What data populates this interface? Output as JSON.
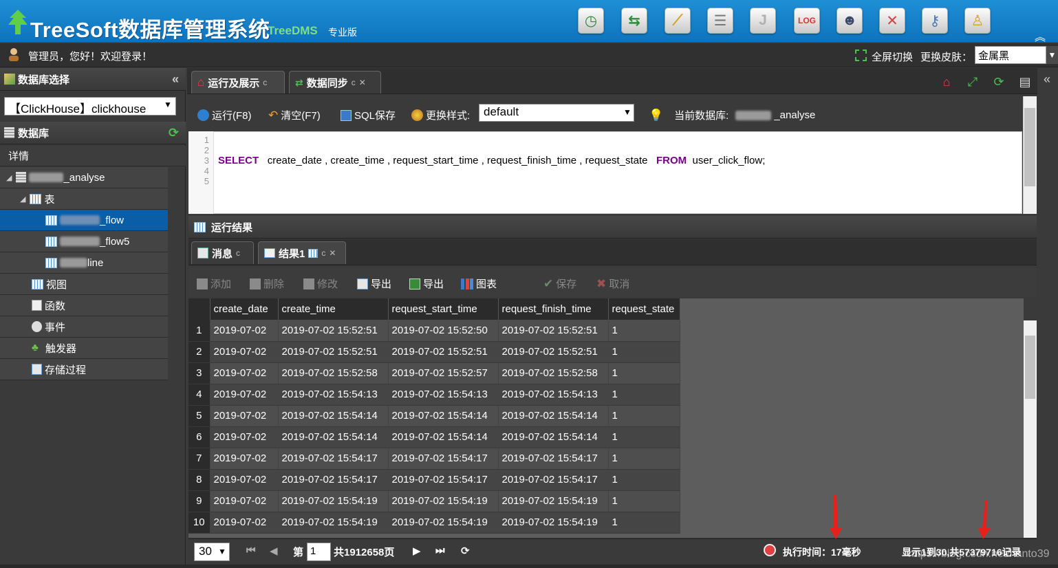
{
  "header": {
    "title": "TreeSoft数据库管理系统",
    "subtitle": "TreeDMS",
    "edition": "专业版",
    "toolbar_icons": [
      "clock-icon",
      "sync-arrows-icon",
      "chart-icon",
      "database-icon",
      "java-icon",
      "log-icon",
      "user-icon",
      "tools-icon",
      "key-icon",
      "person-icon"
    ]
  },
  "welcome": {
    "text": "管理员，您好！欢迎登录！",
    "fullscreen": "全屏切换",
    "skin_label": "更换皮肤：",
    "skin_value": "金属黑"
  },
  "sidebar": {
    "db_select_title": "数据库选择",
    "db_select_value": "【ClickHouse】clickhouse",
    "db_panel_title": "数据库",
    "details": "详情",
    "tree": {
      "db_name": "_analyse",
      "tables_label": "表",
      "tables": [
        "_flow",
        "_flow5",
        "line"
      ],
      "views": "视图",
      "functions": "函数",
      "events": "事件",
      "triggers": "触发器",
      "procedures": "存储过程"
    }
  },
  "tabs": [
    {
      "label": "运行及展示"
    },
    {
      "label": "数据同步"
    }
  ],
  "sql_toolbar": {
    "run": "运行(F8)",
    "clear": "清空(F7)",
    "save": "SQL保存",
    "style_label": "更换样式:",
    "style_value": "default",
    "current_db_label": "当前数据库:",
    "current_db_value": "_analyse"
  },
  "editor": {
    "line_numbers": [
      "1",
      "2",
      "3",
      "4",
      "5"
    ],
    "select_kw": "SELECT",
    "columns": "create_date , create_time , request_start_time , request_finish_time , request_state",
    "from_kw": "FROM",
    "table": "user_click_flow;"
  },
  "results": {
    "title": "运行结果",
    "tabs": [
      {
        "label": "消息"
      },
      {
        "label": "结果1"
      }
    ],
    "toolbar": {
      "add": "添加",
      "delete": "删除",
      "edit": "修改",
      "export1": "导出",
      "export2": "导出",
      "chart": "图表",
      "save": "保存",
      "cancel": "取消"
    },
    "columns": [
      "create_date",
      "create_time",
      "request_start_time",
      "request_finish_time",
      "request_state"
    ],
    "rows": [
      [
        "1",
        "2019-07-02",
        "2019-07-02 15:52:51",
        "2019-07-02 15:52:50",
        "2019-07-02 15:52:51",
        "1"
      ],
      [
        "2",
        "2019-07-02",
        "2019-07-02 15:52:51",
        "2019-07-02 15:52:51",
        "2019-07-02 15:52:51",
        "1"
      ],
      [
        "3",
        "2019-07-02",
        "2019-07-02 15:52:58",
        "2019-07-02 15:52:57",
        "2019-07-02 15:52:58",
        "1"
      ],
      [
        "4",
        "2019-07-02",
        "2019-07-02 15:54:13",
        "2019-07-02 15:54:13",
        "2019-07-02 15:54:13",
        "1"
      ],
      [
        "5",
        "2019-07-02",
        "2019-07-02 15:54:14",
        "2019-07-02 15:54:14",
        "2019-07-02 15:54:14",
        "1"
      ],
      [
        "6",
        "2019-07-02",
        "2019-07-02 15:54:14",
        "2019-07-02 15:54:14",
        "2019-07-02 15:54:14",
        "1"
      ],
      [
        "7",
        "2019-07-02",
        "2019-07-02 15:54:17",
        "2019-07-02 15:54:17",
        "2019-07-02 15:54:17",
        "1"
      ],
      [
        "8",
        "2019-07-02",
        "2019-07-02 15:54:17",
        "2019-07-02 15:54:17",
        "2019-07-02 15:54:17",
        "1"
      ],
      [
        "9",
        "2019-07-02",
        "2019-07-02 15:54:19",
        "2019-07-02 15:54:19",
        "2019-07-02 15:54:19",
        "1"
      ],
      [
        "10",
        "2019-07-02",
        "2019-07-02 15:54:19",
        "2019-07-02 15:54:19",
        "2019-07-02 15:54:19",
        "1"
      ]
    ]
  },
  "pager": {
    "page_size": "30",
    "page_prefix": "第",
    "page_value": "1",
    "page_total": "共1912658页",
    "exec_time": "执行时间：17毫秒",
    "records": "显示1到30,共57379716记录"
  },
  "watermark": "https://blog.csdn.net/hanto39",
  "colors": {
    "accent": "#0e73bd",
    "selected": "#0a5ea7",
    "arrow": "#e8201b"
  }
}
